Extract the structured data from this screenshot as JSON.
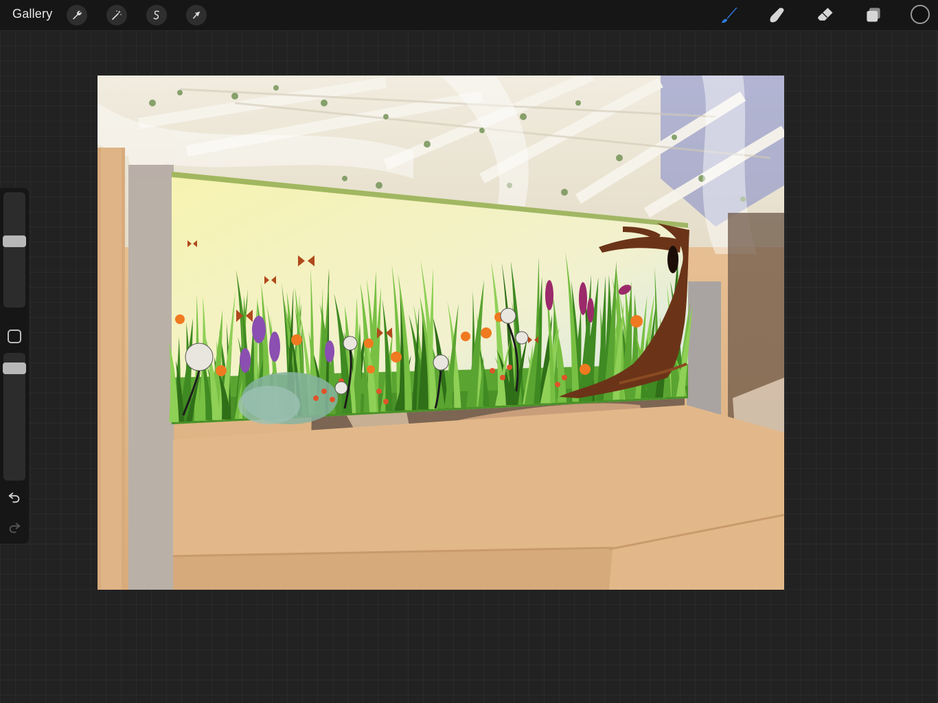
{
  "topbar": {
    "gallery_label": "Gallery",
    "left_tools": [
      {
        "name": "actions",
        "icon": "wrench-icon"
      },
      {
        "name": "adjustments",
        "icon": "magic-wand-icon"
      },
      {
        "name": "selection",
        "icon": "selection-s-icon"
      },
      {
        "name": "transform",
        "icon": "arrow-cursor-icon"
      }
    ],
    "right_tools": [
      {
        "name": "brush",
        "icon": "brush-icon",
        "active": true,
        "color": "#2f7fe6"
      },
      {
        "name": "smudge",
        "icon": "smudge-icon",
        "active": false
      },
      {
        "name": "eraser",
        "icon": "eraser-icon",
        "active": false
      },
      {
        "name": "layers",
        "icon": "layers-icon",
        "active": false
      }
    ],
    "current_color": "#111111"
  },
  "sidebar": {
    "brush_size_level": 0.58,
    "opacity_level": 0.62,
    "modify_icon": "square-icon",
    "undo_icon": "undo-icon",
    "redo_icon": "redo-icon"
  },
  "canvas": {
    "accent_colors": {
      "grass": "#4e9a2c",
      "sky": "#f3f2c0",
      "tree": "#6b3418",
      "flower_orange": "#f07a20",
      "flower_purple": "#8a4fb0",
      "wood": "#e3b88b"
    }
  }
}
